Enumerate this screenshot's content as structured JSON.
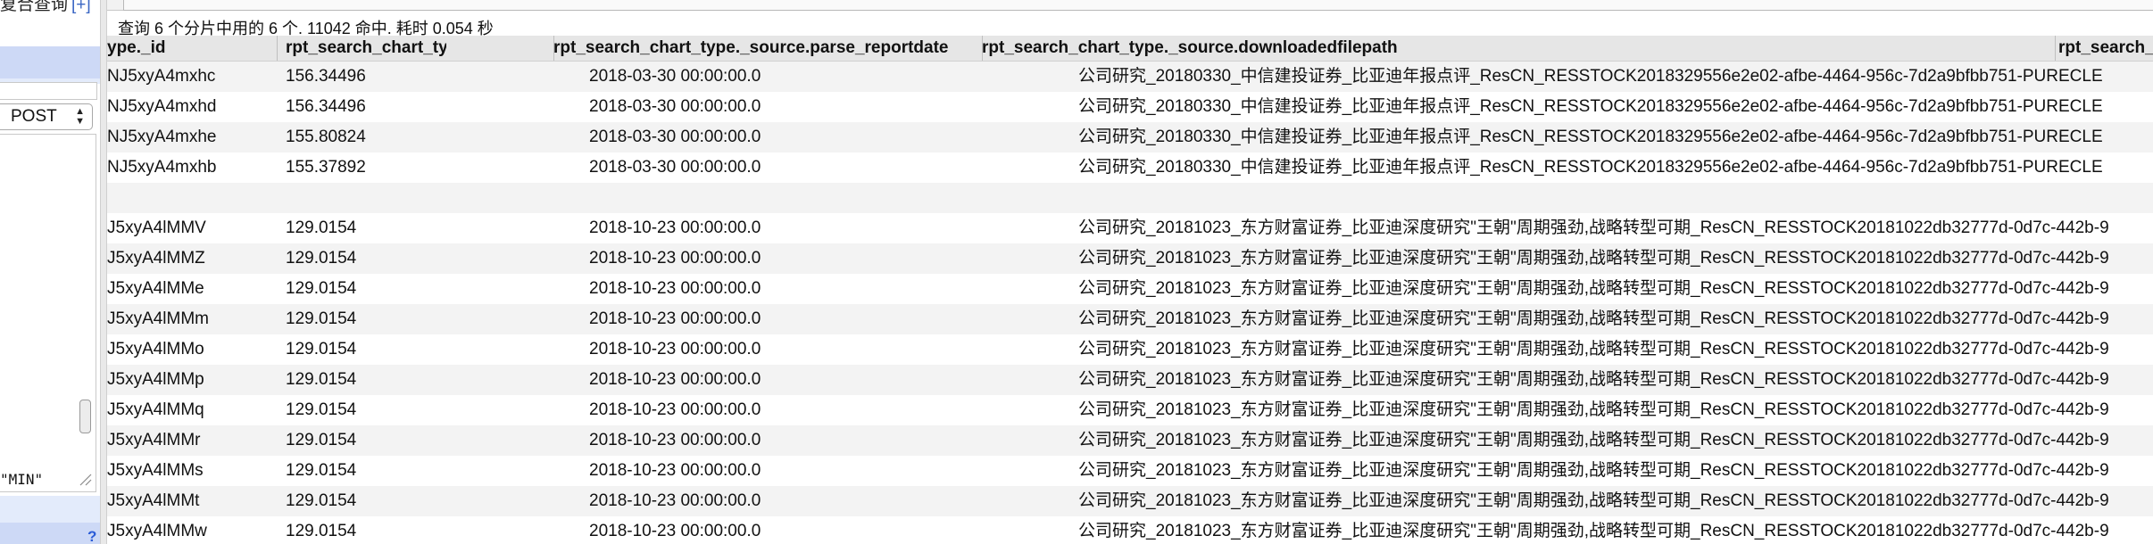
{
  "left_panel": {
    "title": "复合查询",
    "add_label": "[+]",
    "method_select": {
      "selected": "POST"
    },
    "body_tail_text": "\"MIN\"",
    "help_label": "?"
  },
  "results": {
    "summary": "查询 6 个分片中用的 6 个. 11042 命中. 耗时 0.054 秒",
    "columns": [
      "ype._id",
      "rpt_search_chart_type._score",
      "rpt_search_chart_type._source.parse_reportdate",
      "rpt_search_chart_type._source.downloadedfilepath",
      "rpt_search_chart_type"
    ],
    "rows": [
      {
        "id": "NJ5xyA4mxhc",
        "score": "156.34496",
        "date": "2018-03-30 00:00:00.0",
        "path": "公司研究_20180330_中信建投证券_比亚迪年报点评_ResCN_RESSTOCK2018329556e2e02-afbe-4464-956c-7d2a9bfbb751-PURECLE",
        "extra": ""
      },
      {
        "id": "NJ5xyA4mxhd",
        "score": "156.34496",
        "date": "2018-03-30 00:00:00.0",
        "path": "公司研究_20180330_中信建投证券_比亚迪年报点评_ResCN_RESSTOCK2018329556e2e02-afbe-4464-956c-7d2a9bfbb751-PURECLE",
        "extra": ""
      },
      {
        "id": "NJ5xyA4mxhe",
        "score": "155.80824",
        "date": "2018-03-30 00:00:00.0",
        "path": "公司研究_20180330_中信建投证券_比亚迪年报点评_ResCN_RESSTOCK2018329556e2e02-afbe-4464-956c-7d2a9bfbb751-PURECLE",
        "extra": ""
      },
      {
        "id": "NJ5xyA4mxhb",
        "score": "155.37892",
        "date": "2018-03-30 00:00:00.0",
        "path": "公司研究_20180330_中信建投证券_比亚迪年报点评_ResCN_RESSTOCK2018329556e2e02-afbe-4464-956c-7d2a9bfbb751-PURECLE",
        "extra": ""
      },
      {
        "id": "",
        "score": "",
        "date": "",
        "path": "",
        "extra": ""
      },
      {
        "id": "J5xyA4lMMV",
        "score": "129.0154",
        "date": "2018-10-23 00:00:00.0",
        "path": "公司研究_20181023_东方财富证券_比亚迪深度研究\"王朝\"周期强劲,战略转型可期_ResCN_RESSTOCK20181022db32777d-0d7c-442b-9",
        "extra": ""
      },
      {
        "id": "J5xyA4lMMZ",
        "score": "129.0154",
        "date": "2018-10-23 00:00:00.0",
        "path": "公司研究_20181023_东方财富证券_比亚迪深度研究\"王朝\"周期强劲,战略转型可期_ResCN_RESSTOCK20181022db32777d-0d7c-442b-9",
        "extra": ""
      },
      {
        "id": "J5xyA4lMMe",
        "score": "129.0154",
        "date": "2018-10-23 00:00:00.0",
        "path": "公司研究_20181023_东方财富证券_比亚迪深度研究\"王朝\"周期强劲,战略转型可期_ResCN_RESSTOCK20181022db32777d-0d7c-442b-9",
        "extra": ""
      },
      {
        "id": "J5xyA4lMMm",
        "score": "129.0154",
        "date": "2018-10-23 00:00:00.0",
        "path": "公司研究_20181023_东方财富证券_比亚迪深度研究\"王朝\"周期强劲,战略转型可期_ResCN_RESSTOCK20181022db32777d-0d7c-442b-9",
        "extra": ""
      },
      {
        "id": "J5xyA4lMMo",
        "score": "129.0154",
        "date": "2018-10-23 00:00:00.0",
        "path": "公司研究_20181023_东方财富证券_比亚迪深度研究\"王朝\"周期强劲,战略转型可期_ResCN_RESSTOCK20181022db32777d-0d7c-442b-9",
        "extra": ""
      },
      {
        "id": "J5xyA4lMMp",
        "score": "129.0154",
        "date": "2018-10-23 00:00:00.0",
        "path": "公司研究_20181023_东方财富证券_比亚迪深度研究\"王朝\"周期强劲,战略转型可期_ResCN_RESSTOCK20181022db32777d-0d7c-442b-9",
        "extra": ""
      },
      {
        "id": "J5xyA4lMMq",
        "score": "129.0154",
        "date": "2018-10-23 00:00:00.0",
        "path": "公司研究_20181023_东方财富证券_比亚迪深度研究\"王朝\"周期强劲,战略转型可期_ResCN_RESSTOCK20181022db32777d-0d7c-442b-9",
        "extra": ""
      },
      {
        "id": "J5xyA4lMMr",
        "score": "129.0154",
        "date": "2018-10-23 00:00:00.0",
        "path": "公司研究_20181023_东方财富证券_比亚迪深度研究\"王朝\"周期强劲,战略转型可期_ResCN_RESSTOCK20181022db32777d-0d7c-442b-9",
        "extra": ""
      },
      {
        "id": "J5xyA4lMMs",
        "score": "129.0154",
        "date": "2018-10-23 00:00:00.0",
        "path": "公司研究_20181023_东方财富证券_比亚迪深度研究\"王朝\"周期强劲,战略转型可期_ResCN_RESSTOCK20181022db32777d-0d7c-442b-9",
        "extra": ""
      },
      {
        "id": "J5xyA4lMMt",
        "score": "129.0154",
        "date": "2018-10-23 00:00:00.0",
        "path": "公司研究_20181023_东方财富证券_比亚迪深度研究\"王朝\"周期强劲,战略转型可期_ResCN_RESSTOCK20181022db32777d-0d7c-442b-9",
        "extra": ""
      },
      {
        "id": "J5xyA4lMMw",
        "score": "129.0154",
        "date": "2018-10-23 00:00:00.0",
        "path": "公司研究_20181023_东方财富证券_比亚迪深度研究\"王朝\"周期强劲,战略转型可期_ResCN_RESSTOCK20181022db32777d-0d7c-442b-9",
        "extra": ""
      }
    ]
  },
  "colors": {
    "accent_blue": "#3a66c4",
    "panel_band": "#cdd9f6",
    "header_bg": "#e6e6e6",
    "row_alt": "#f3f3f3"
  }
}
